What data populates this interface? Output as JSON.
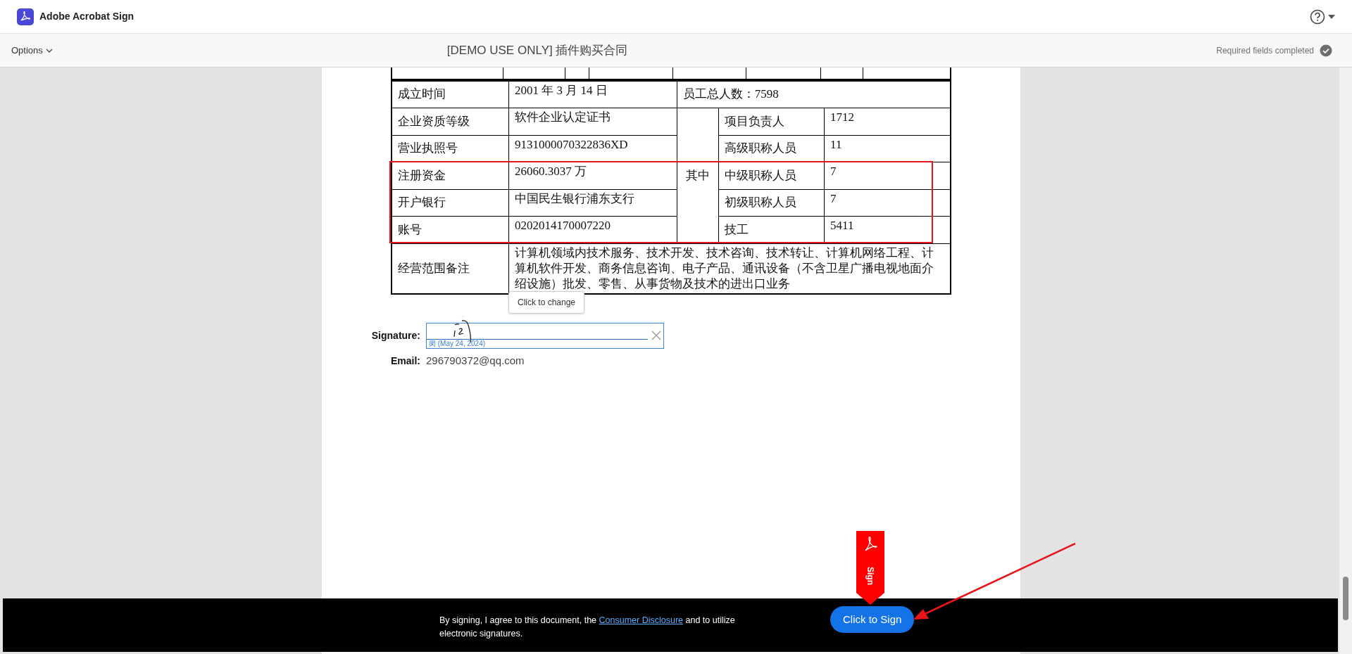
{
  "app": {
    "title": "Adobe Acrobat Sign"
  },
  "toolbar": {
    "options": "Options",
    "document_title": "[DEMO USE ONLY] 插件购买合同",
    "status": "Required fields completed",
    "completed": true
  },
  "table": {
    "rows": [
      {
        "cells": [
          {
            "text": "成立时间",
            "kind": "label"
          },
          {
            "text": "2001 年 3 月 14 日",
            "kind": "value"
          },
          {
            "text": "员工总人数：7598",
            "kind": "label",
            "colspan": 3
          }
        ]
      },
      {
        "cells": [
          {
            "text": "企业资质等级",
            "kind": "label"
          },
          {
            "text": "软件企业认定证书",
            "kind": "value"
          },
          {
            "text": "其中",
            "kind": "center",
            "rowspan": 5
          },
          {
            "text": "项目负责人",
            "kind": "label"
          },
          {
            "text": "1712",
            "kind": "value"
          }
        ]
      },
      {
        "cells": [
          {
            "text": "营业执照号",
            "kind": "label"
          },
          {
            "text": "9131000070322836XD",
            "kind": "value"
          },
          {
            "text": "高级职称人员",
            "kind": "label"
          },
          {
            "text": "11",
            "kind": "value"
          }
        ]
      },
      {
        "cells": [
          {
            "text": "注册资金",
            "kind": "label"
          },
          {
            "text": "26060.3037 万",
            "kind": "value"
          },
          {
            "text": "中级职称人员",
            "kind": "label"
          },
          {
            "text": "7",
            "kind": "value"
          }
        ]
      },
      {
        "cells": [
          {
            "text": "开户银行",
            "kind": "label"
          },
          {
            "text": "中国民生银行浦东支行",
            "kind": "value"
          },
          {
            "text": "初级职称人员",
            "kind": "label"
          },
          {
            "text": "7",
            "kind": "value"
          }
        ]
      },
      {
        "cells": [
          {
            "text": "账号",
            "kind": "label"
          },
          {
            "text": "0202014170007220",
            "kind": "value"
          },
          {
            "text": "技工",
            "kind": "label"
          },
          {
            "text": "5411",
            "kind": "value"
          }
        ]
      },
      {
        "cells": [
          {
            "text": "经营范围备注",
            "kind": "label"
          },
          {
            "text": "计算机领域内技术服务、技术开发、技术咨询、技术转让、计算机网络工程、计算机软件开发、商务信息咨询、电子产品、通讯设备（不含卫星广播电视地面介绍设施）批发、零售、从事货物及技术的进出口业务",
            "kind": "value",
            "colspan": 4
          }
        ]
      }
    ]
  },
  "signature": {
    "label": "Signature:",
    "signer_mark": "闵",
    "date": "(May 24, 2024)",
    "tooltip": "Click to change"
  },
  "email": {
    "label": "Email:",
    "value": "296790372@qq.com"
  },
  "sign_tag": {
    "label": "Sign"
  },
  "footer": {
    "text_before": "By signing, I agree to this document, the ",
    "link": "Consumer Disclosure",
    "text_after": " and to utilize electronic signatures.",
    "button": "Click to Sign"
  }
}
